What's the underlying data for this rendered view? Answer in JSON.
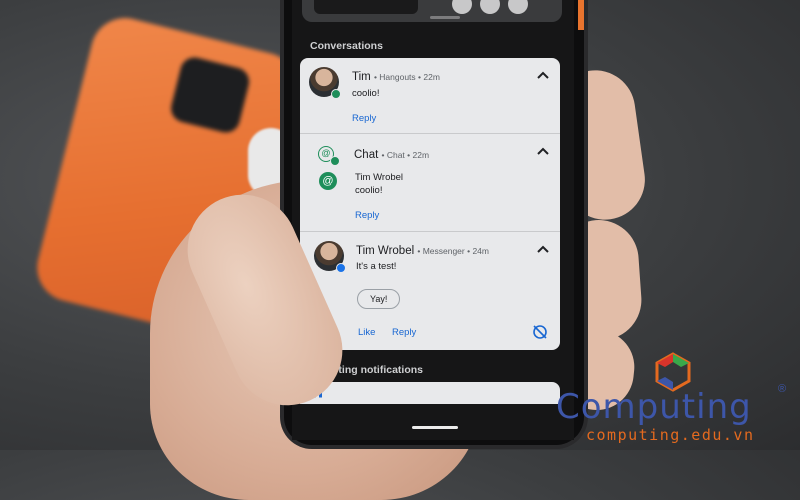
{
  "conversations": {
    "section_title": "Conversations",
    "items": [
      {
        "name": "Tim",
        "meta": "• Hangouts • 22m",
        "message": "coolio!",
        "actions": [
          "Reply"
        ],
        "badge_color": "#1e8e5a"
      },
      {
        "name": "Chat",
        "meta": "• Chat • 22m",
        "sender": "Tim Wrobel",
        "message": "coolio!",
        "actions": [
          "Reply"
        ],
        "icon": "chat-at-icon",
        "badge_color": "#1e8e5a"
      },
      {
        "name": "Tim Wrobel",
        "meta": "• Messenger • 24m",
        "message": "It's a test!",
        "smart_reply": "Yay!",
        "actions": [
          "Like",
          "Reply"
        ],
        "badge_color": "#1a73e8"
      }
    ]
  },
  "alerting": {
    "section_title": "Alerting notifications",
    "icon": "home-icon"
  },
  "watermark": {
    "word": "Computing",
    "registered": "®",
    "url": "computing.edu.vn"
  },
  "colors": {
    "accent": "#1967d2",
    "phone_orange": "#e66f30",
    "card_bg": "#e8e9eb",
    "watermark_blue": "#3d56a9",
    "watermark_orange": "#e46a1f"
  }
}
